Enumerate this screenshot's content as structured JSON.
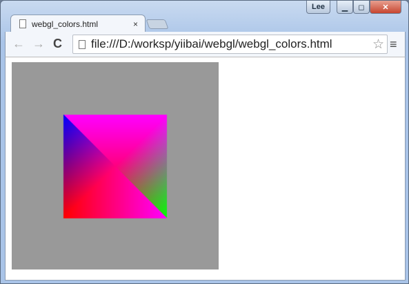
{
  "window": {
    "user_label": "Lee",
    "minimize": "▁",
    "maximize": "◻",
    "close": "✕"
  },
  "tab": {
    "title": "webgl_colors.html",
    "close": "×"
  },
  "toolbar": {
    "back": "←",
    "forward": "→",
    "reload": "C",
    "url": "file:///D:/worksp/yiibai/webgl/webgl_colors.html",
    "star": "☆",
    "menu": "≡"
  },
  "scene": {
    "clear_color": "#999999",
    "vertices": {
      "top_left": "#0000ff",
      "top_right": "#ff00ff",
      "bottom_left": "#ff0000",
      "bottom_right": "#00ff00"
    }
  }
}
